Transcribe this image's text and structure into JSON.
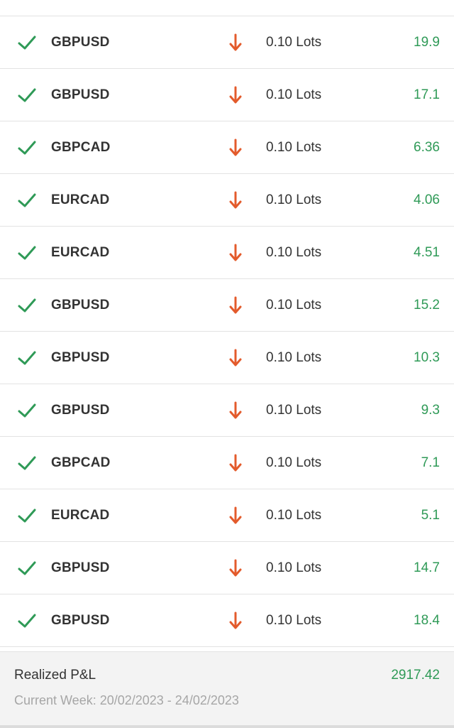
{
  "colors": {
    "profit": "#2f9a57",
    "sell_arrow": "#e35b2c",
    "check": "#2f9a57"
  },
  "trades": [
    {
      "status_icon": "check-icon",
      "symbol": "GBPUSD",
      "direction_icon": "arrow-down-icon",
      "volume": "0.10 Lots",
      "pnl": "19.9"
    },
    {
      "status_icon": "check-icon",
      "symbol": "GBPUSD",
      "direction_icon": "arrow-down-icon",
      "volume": "0.10 Lots",
      "pnl": "17.1"
    },
    {
      "status_icon": "check-icon",
      "symbol": "GBPCAD",
      "direction_icon": "arrow-down-icon",
      "volume": "0.10 Lots",
      "pnl": "6.36"
    },
    {
      "status_icon": "check-icon",
      "symbol": "EURCAD",
      "direction_icon": "arrow-down-icon",
      "volume": "0.10 Lots",
      "pnl": "4.06"
    },
    {
      "status_icon": "check-icon",
      "symbol": "EURCAD",
      "direction_icon": "arrow-down-icon",
      "volume": "0.10 Lots",
      "pnl": "4.51"
    },
    {
      "status_icon": "check-icon",
      "symbol": "GBPUSD",
      "direction_icon": "arrow-down-icon",
      "volume": "0.10 Lots",
      "pnl": "15.2"
    },
    {
      "status_icon": "check-icon",
      "symbol": "GBPUSD",
      "direction_icon": "arrow-down-icon",
      "volume": "0.10 Lots",
      "pnl": "10.3"
    },
    {
      "status_icon": "check-icon",
      "symbol": "GBPUSD",
      "direction_icon": "arrow-down-icon",
      "volume": "0.10 Lots",
      "pnl": "9.3"
    },
    {
      "status_icon": "check-icon",
      "symbol": "GBPCAD",
      "direction_icon": "arrow-down-icon",
      "volume": "0.10 Lots",
      "pnl": "7.1"
    },
    {
      "status_icon": "check-icon",
      "symbol": "EURCAD",
      "direction_icon": "arrow-down-icon",
      "volume": "0.10 Lots",
      "pnl": "5.1"
    },
    {
      "status_icon": "check-icon",
      "symbol": "GBPUSD",
      "direction_icon": "arrow-down-icon",
      "volume": "0.10 Lots",
      "pnl": "14.7"
    },
    {
      "status_icon": "check-icon",
      "symbol": "GBPUSD",
      "direction_icon": "arrow-down-icon",
      "volume": "0.10 Lots",
      "pnl": "18.4"
    }
  ],
  "summary": {
    "label": "Realized P&L",
    "value": "2917.42",
    "period": "Current Week: 20/02/2023 - 24/02/2023"
  }
}
